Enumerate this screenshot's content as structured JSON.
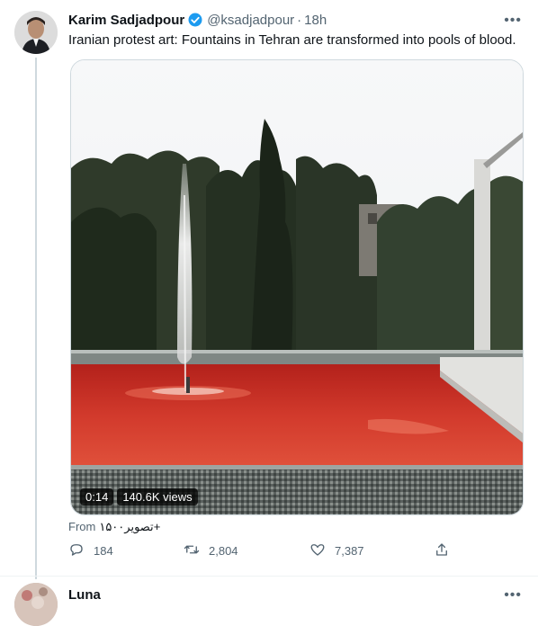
{
  "tweet": {
    "author_name": "Karim Sadjadpour",
    "handle": "@ksadjadpour",
    "separator": "·",
    "time": "18h",
    "text": "Iranian protest art: Fountains in Tehran are transformed into pools of blood.",
    "more_label": "•••",
    "media": {
      "duration": "0:14",
      "views": "140.6K views"
    },
    "source_prefix": "From",
    "source_app": "تصویر۱۵۰۰+",
    "actions": {
      "replies": "184",
      "retweets": "2,804",
      "likes": "7,387"
    }
  },
  "reply": {
    "author_name": "Luna",
    "more_label": "•••"
  },
  "colors": {
    "verified": "#1d9bf0",
    "secondary_text": "#536471",
    "border": "#cfd9de",
    "water_red": "#c8271e"
  },
  "icons": [
    "verified-badge-icon",
    "more-icon",
    "reply-icon",
    "retweet-icon",
    "like-icon",
    "share-icon"
  ]
}
